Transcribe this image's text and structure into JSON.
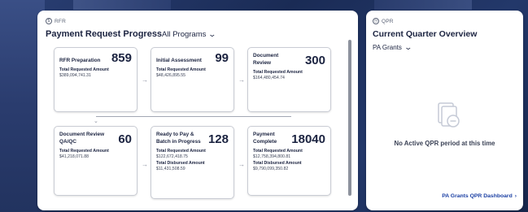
{
  "rfr_panel": {
    "eyebrow": "RFR",
    "title": "Payment Request Progress",
    "program_select": "All Programs",
    "cards": [
      {
        "name": "RFR Preparation",
        "count": "859",
        "label1": "Total Requested Amount",
        "amount1": "$389,094,741.31"
      },
      {
        "name": "Initial Assessment",
        "count": "99",
        "label1": "Total Requested Amount",
        "amount1": "$48,426,895.55"
      },
      {
        "name": "Document Review",
        "count": "300",
        "label1": "Total Requested Amount",
        "amount1": "$164,480,454.74"
      },
      {
        "name": "Document Review QA/QC",
        "count": "60",
        "label1": "Total Requested Amount",
        "amount1": "$41,218,071.88"
      },
      {
        "name": "Ready to Pay & Batch in Progress",
        "count": "128",
        "label1": "Total Requested Amount",
        "amount1": "$122,672,418.75",
        "label2": "Total Disbursed Amount",
        "amount2": "$11,431,508.59"
      },
      {
        "name": "Payment Complete",
        "count": "18040",
        "label1": "Total Requested Amount",
        "amount1": "$12,758,394,800.81",
        "label2": "Total Disbursed Amount",
        "amount2": "$9,790,099,350.82"
      }
    ]
  },
  "qpr_panel": {
    "eyebrow": "QPR",
    "title": "Current Quarter Overview",
    "program_select": "PA Grants",
    "empty_message": "No Active QPR period at this time",
    "dashboard_link": "PA Grants QPR Dashboard"
  },
  "icons": {
    "rfr": "dollar-circle-icon",
    "qpr": "clock-icon",
    "chevron": "chevron-down-icon",
    "arrow": "arrow-right-icon",
    "empty": "document-minus-icon",
    "link": "chevron-right-icon"
  },
  "colors": {
    "background": "#1c2f5b",
    "link": "#1a3fa3",
    "text": "#1b2340"
  }
}
